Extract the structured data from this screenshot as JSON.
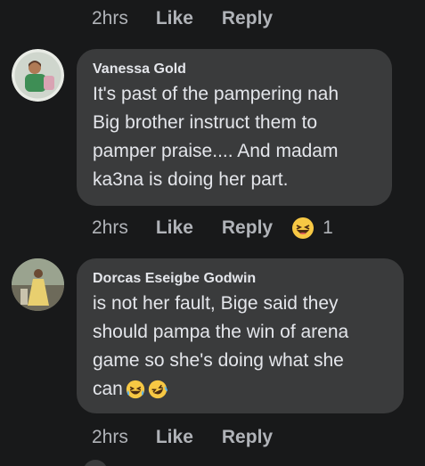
{
  "top_actions": {
    "time": "2hrs",
    "like": "Like",
    "reply": "Reply"
  },
  "comments": [
    {
      "author": "Vanessa Gold",
      "text": "It's past of the pampering nah\nBig brother instruct them to\npamper praise.... And madam\nka3na is doing her part.",
      "time": "2hrs",
      "like": "Like",
      "reply": "Reply",
      "reaction_icon": "laughing-emoji-icon",
      "reaction_count": "1"
    },
    {
      "author": "Dorcas Eseigbe Godwin",
      "text": "is not her fault, Bige said they\nshould pampa the win of arena\ngame so she's doing what she\ncan",
      "emojis": [
        "laughing-emoji-icon",
        "rolling-laughing-emoji-icon"
      ],
      "time": "2hrs",
      "like": "Like",
      "reply": "Reply"
    }
  ],
  "colors": {
    "background": "#18191a",
    "bubble": "#3a3b3c",
    "text": "#e4e6eb",
    "secondary_text": "#b0b3b8",
    "emoji_yellow": "#f7c844"
  }
}
